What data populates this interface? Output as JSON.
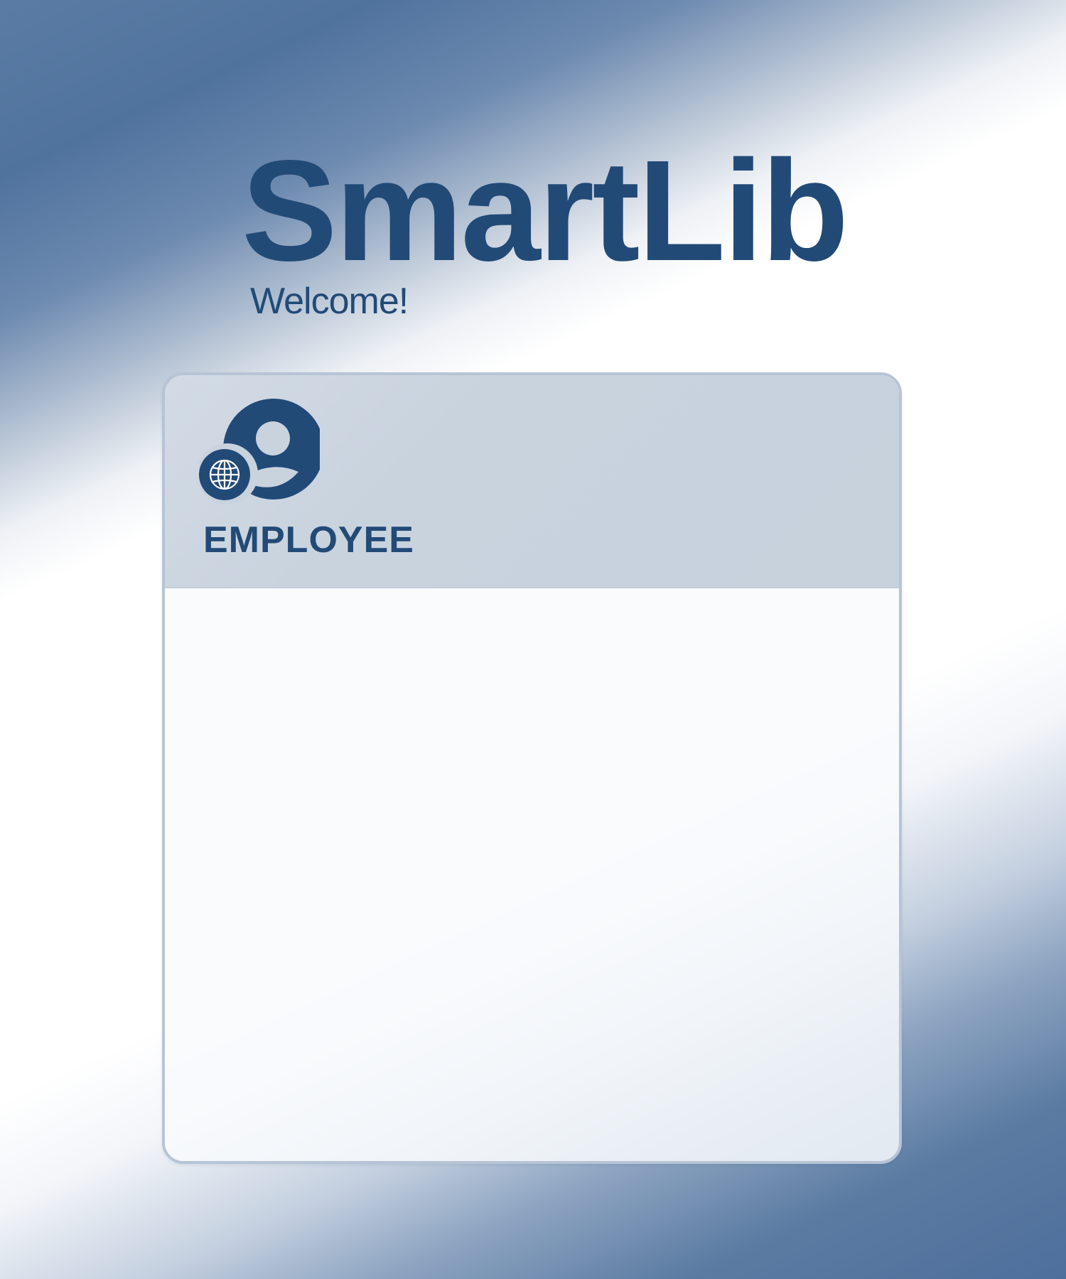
{
  "brand": {
    "logo_text": "SmartLib",
    "welcome": "Welcome!"
  },
  "card": {
    "role_label": "EMPLOYEE",
    "icon": "employee-globe-icon"
  },
  "colors": {
    "brand": "#224a77",
    "card_header": "#c9d3de",
    "card_border": "#b7c4d5",
    "card_body": "#f8fafd"
  }
}
